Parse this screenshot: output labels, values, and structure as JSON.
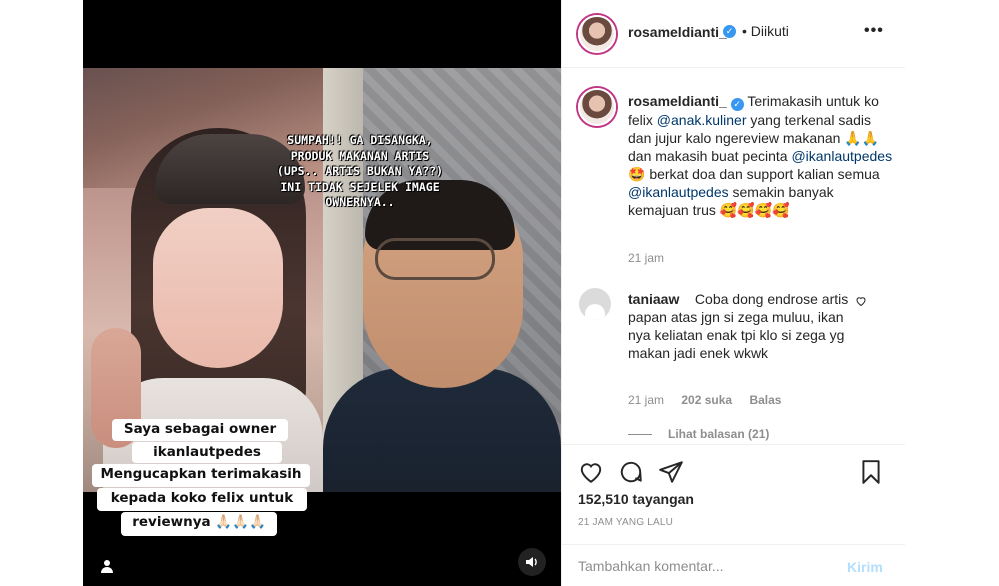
{
  "media": {
    "overlay_right": "SUMPAH!! GA DISANGKA,\nPRODUK MAKANAN ARTIS\n(UPS.. ARTIS BUKAN YA??)\nINI TIDAK SEJELEK IMAGE\nOWNERNYA..",
    "overlay_left": [
      "Saya sebagai owner",
      "ikanlautpedes",
      "Mengucapkan terimakasih",
      "kepada koko felix untuk",
      "reviewnya 🙏🏻🙏🏻🙏🏻"
    ],
    "volume_icon": "speaker-icon",
    "tag_icon": "person-icon"
  },
  "header": {
    "username": "rosameldianti_",
    "separator": "•",
    "follow_status": "Diikuti",
    "more": "•••"
  },
  "caption": {
    "username": "rosameldianti_",
    "text_1": "Terimakasih untuk ko felix ",
    "mention_1": "@anak.kuliner",
    "text_2": " yang terkenal sadis dan jujur kalo ngereview makanan 🙏🙏 dan makasih buat pecinta ",
    "mention_2": "@ikanlautpedes",
    "text_3": " 🤩 berkat doa dan support kalian semua ",
    "mention_3": "@ikanlautpedes",
    "text_4": " semakin banyak kemajuan trus 🥰🥰🥰🥰",
    "time": "21 jam"
  },
  "comment": {
    "username": "taniaaw",
    "text": "Coba dong endrose artis papan atas jgn si zega muluu, ikan nya keliatan enak tpi klo si zega yg makan jadi enek wkwk",
    "time": "21 jam",
    "likes": "202 suka",
    "reply": "Balas",
    "view_replies": "Lihat balasan (21)"
  },
  "actions": {
    "views": "152,510 tayangan",
    "ago": "21 JAM YANG LALU"
  },
  "comment_box": {
    "placeholder": "Tambahkan komentar...",
    "post": "Kirim"
  },
  "colors": {
    "link": "#00376b",
    "muted": "#8e8e8e",
    "verified": "#3897f0",
    "post_disabled": "#b2dffc"
  }
}
